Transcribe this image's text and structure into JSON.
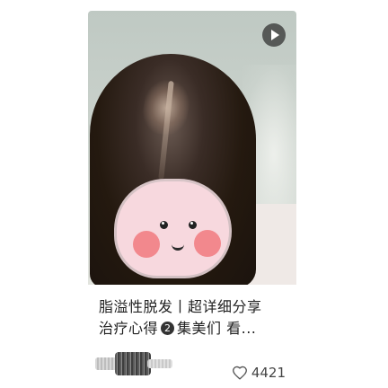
{
  "card": {
    "media_type": "video",
    "play_icon": "play-icon",
    "title_line1": "脂溢性脱发丨超详细分享",
    "title_line2_pre": "治疗心得",
    "title_badge": "2",
    "title_line2_post": "集美们 看...",
    "author_name_hidden": true,
    "likes_icon": "heart-outline-icon",
    "likes_count": "4421"
  },
  "colors": {
    "title_text": "#222222",
    "meta_text": "#444444",
    "badge_bg": "#333333"
  }
}
